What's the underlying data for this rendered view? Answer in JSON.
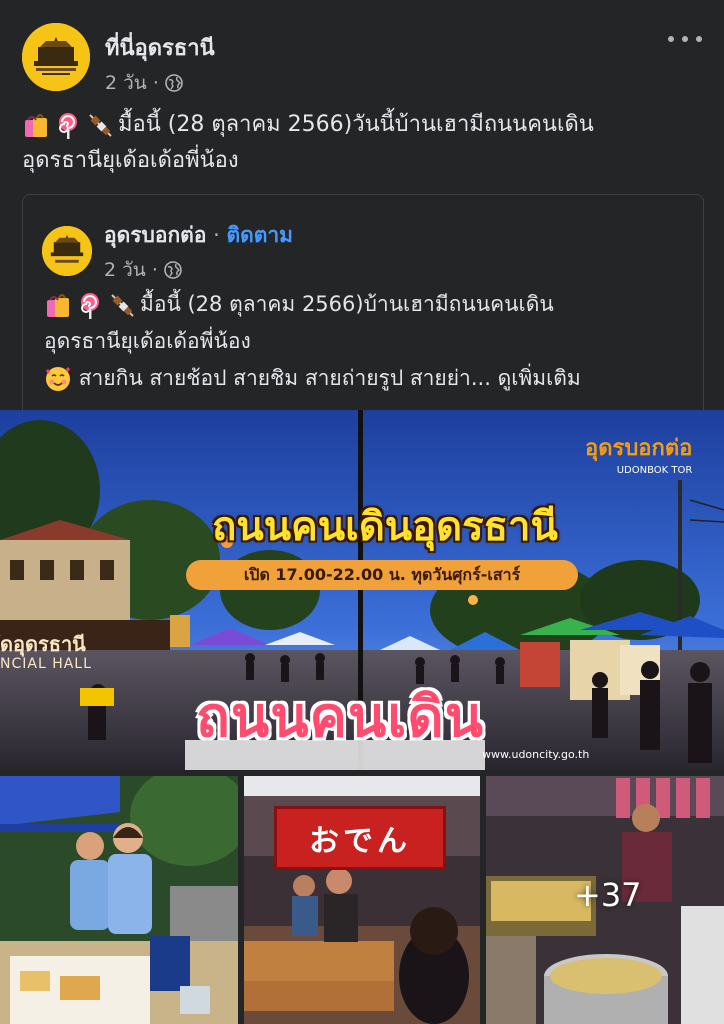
{
  "post": {
    "page_name": "ที่นี่อุดรธานี",
    "time": "2 วัน ·",
    "text_line1": "มื้อนี้ (28 ตุลาคม 2566)วันนี้บ้านเฮามีถนนคนเดิน",
    "text_line2": "อุดรธานียุเด้อเด้อพี่น้อง",
    "emojis": [
      "shopping-bags-emoji",
      "lollipop-emoji",
      "skewer-emoji"
    ]
  },
  "shared": {
    "page_name": "อุดรบอกต่อ",
    "separator": " · ",
    "follow_label": "ติดตาม",
    "time": "2 วัน ·",
    "text_line1": "มื้อนี้ (28 ตุลาคม 2566)บ้านเฮามีถนนคนเดิน",
    "text_line2": "อุดรธานียุเด้อเด้อพี่น้อง",
    "text_line3": "สายกิน สายช้อป สายชิม สายถ่ายรูป สายย่า...",
    "see_more_label": "ดูเพิ่มเติม",
    "emojis": [
      "shopping-bags-emoji",
      "lollipop-emoji",
      "skewer-emoji",
      "smiling-hearts-emoji"
    ]
  },
  "photo": {
    "title": "ถนนคนเดินอุดรธานี",
    "hours": "เปิด 17.00-22.00 น. ทุดวันศุกร์-เสาร์",
    "brand": "อุดรบอกต่อ",
    "brand_sub": "UDONBOK TOR",
    "sign": "ถนนคนเดิน",
    "hall_text": "ัดอุดรธานี",
    "hall_sub": "NCIAL HALL",
    "url": "www.udoncity.go.th",
    "oden_sign": "おでん",
    "more_count": "+37"
  },
  "colors": {
    "background": "#242526",
    "text": "#e4e6eb",
    "secondary_text": "#b0b3b8",
    "link": "#4599ff",
    "avatar": "#f5c416"
  }
}
